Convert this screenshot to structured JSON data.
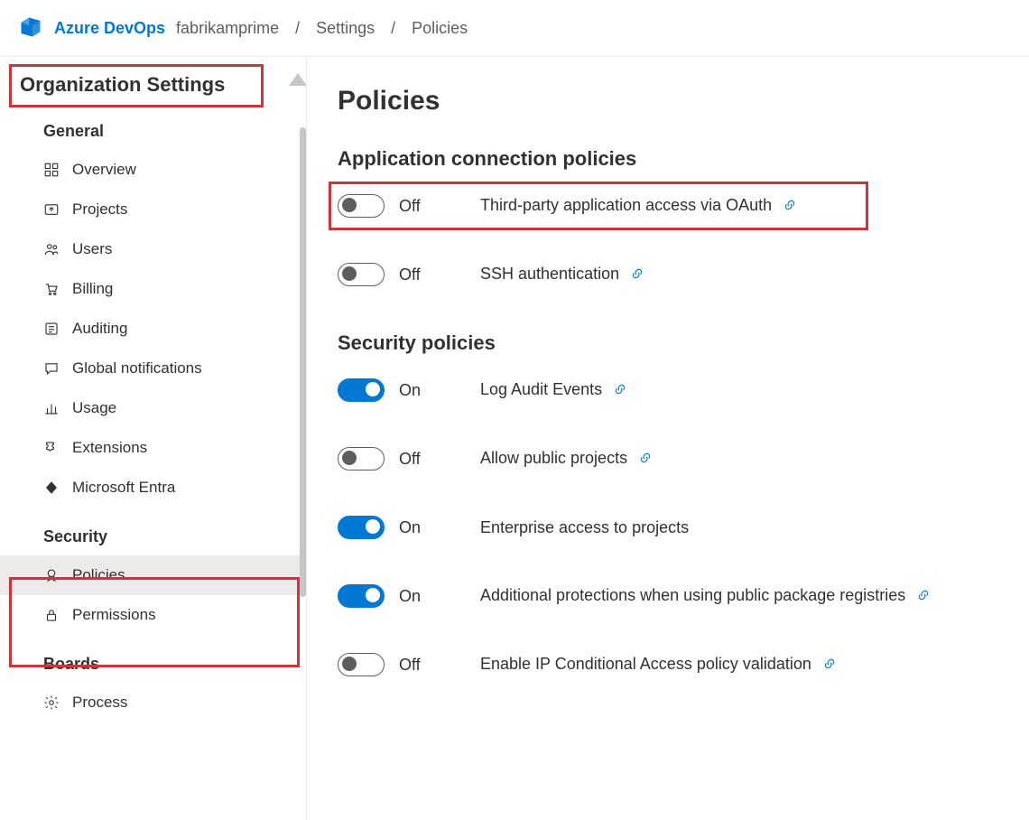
{
  "header": {
    "brand": "Azure DevOps",
    "org": "fabrikamprime",
    "crumb1": "Settings",
    "crumb2": "Policies"
  },
  "sidebar": {
    "title": "Organization Settings",
    "general_label": "General",
    "general": {
      "overview": "Overview",
      "projects": "Projects",
      "users": "Users",
      "billing": "Billing",
      "auditing": "Auditing",
      "notifications": "Global notifications",
      "usage": "Usage",
      "extensions": "Extensions",
      "entra": "Microsoft Entra"
    },
    "security_label": "Security",
    "security": {
      "policies": "Policies",
      "permissions": "Permissions"
    },
    "boards_label": "Boards",
    "boards": {
      "process": "Process"
    }
  },
  "main": {
    "title": "Policies",
    "section_app": "Application connection policies",
    "section_sec": "Security policies",
    "state_on": "On",
    "state_off": "Off",
    "policies": {
      "oauth": {
        "state": "Off",
        "label": "Third-party application access via OAuth",
        "on": false,
        "link": true
      },
      "ssh": {
        "state": "Off",
        "label": "SSH authentication",
        "on": false,
        "link": true
      },
      "audit": {
        "state": "On",
        "label": "Log Audit Events",
        "on": true,
        "link": true
      },
      "public": {
        "state": "Off",
        "label": "Allow public projects",
        "on": false,
        "link": true
      },
      "enterprise": {
        "state": "On",
        "label": "Enterprise access to projects",
        "on": true,
        "link": false
      },
      "packages": {
        "state": "On",
        "label": "Additional protections when using public package registries",
        "on": true,
        "link": true
      },
      "ipca": {
        "state": "Off",
        "label": "Enable IP Conditional Access policy validation",
        "on": false,
        "link": true
      }
    }
  }
}
